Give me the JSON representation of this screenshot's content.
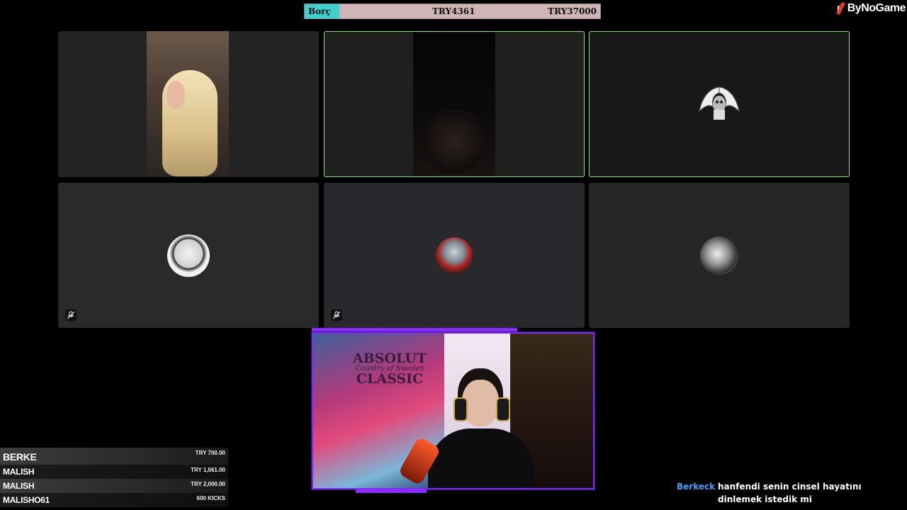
{
  "goal": {
    "label": "Borç",
    "current": "TRY4361",
    "target": "TRY37000",
    "progress_fraction": 0.118,
    "colors": {
      "fill": "#3fd0cf",
      "track": "#cfb4b8"
    }
  },
  "brand": {
    "name": "ByNoGame",
    "icon": "bynogame-logo-icon"
  },
  "participants": [
    {
      "id": "p1",
      "type": "camera",
      "active": false,
      "muted": false
    },
    {
      "id": "p2",
      "type": "camera",
      "active": true,
      "muted": false
    },
    {
      "id": "p3",
      "type": "avatar",
      "avatar": "winged-skull-avatar",
      "active": true,
      "muted": false
    },
    {
      "id": "p4",
      "type": "avatar",
      "avatar": "gangster-avatar",
      "active": false,
      "muted": true
    },
    {
      "id": "p5",
      "type": "avatar",
      "avatar": "assassin-avatar",
      "active": false,
      "muted": true
    },
    {
      "id": "p6",
      "type": "avatar",
      "avatar": "couple-avatar",
      "active": false,
      "muted": false
    }
  ],
  "streamer_cam": {
    "poster_title": "ABSOLUT",
    "poster_sub": "Country of Sweden",
    "poster_line": "CLASSIC",
    "frame_color": "#7b2bff"
  },
  "donations": [
    {
      "name": "BERKE",
      "amount": "TRY 700.00"
    },
    {
      "name": "MALISH",
      "amount": "TRY 1,661.00"
    },
    {
      "name": "MALISH",
      "amount": "TRY 2,000.00"
    },
    {
      "name": "MALISHO61",
      "amount": "600 KICKS"
    }
  ],
  "chat": {
    "user": "Berkeck",
    "message": "hanfendi senin cinsel hayatını dinlemek istedik mi",
    "user_color": "#4aa0ff"
  }
}
